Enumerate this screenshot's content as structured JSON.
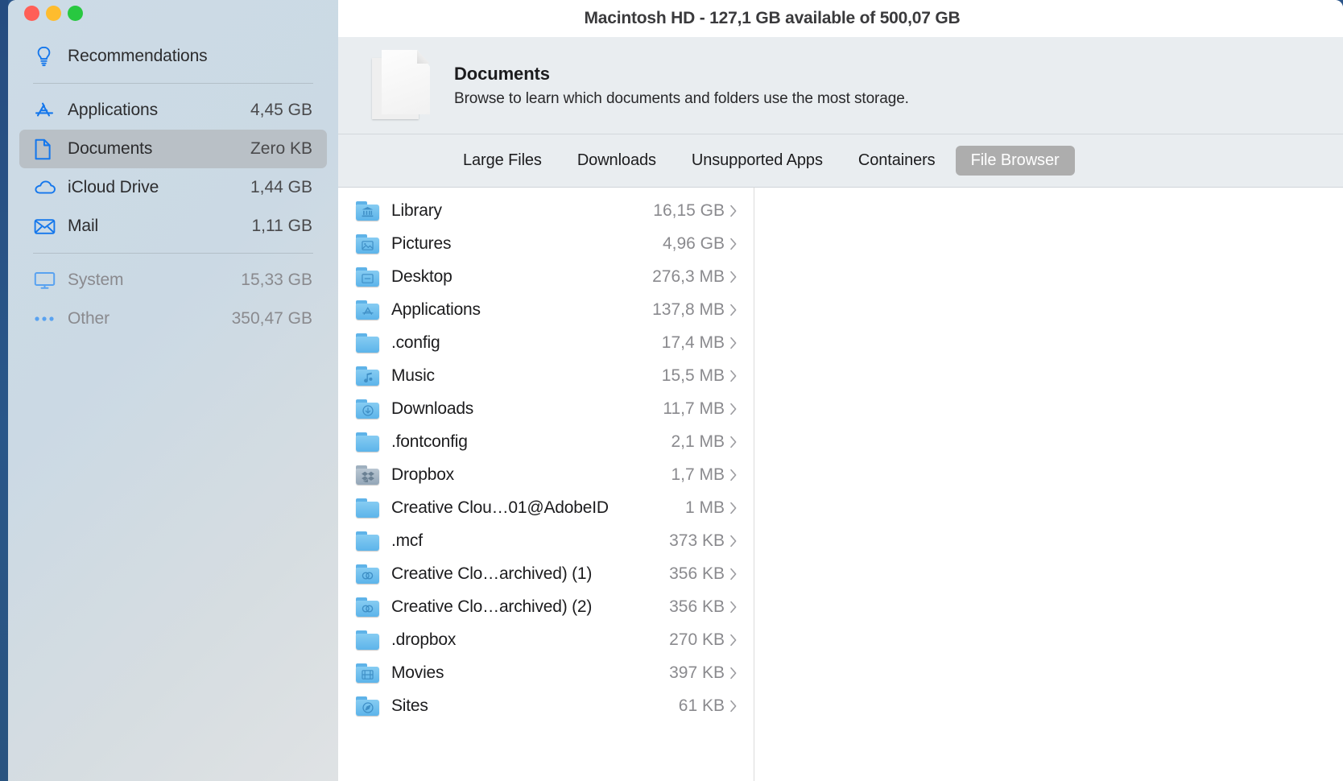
{
  "window": {
    "title": "Macintosh HD - 127,1 GB available of 500,07 GB",
    "traffic_lights": {
      "close_color": "#ff5f57",
      "minimize_color": "#febc2e",
      "maximize_color": "#28c840"
    }
  },
  "sidebar": {
    "items": [
      {
        "label": "Recommendations",
        "size": "",
        "icon": "lightbulb-icon",
        "selected": false,
        "dim": false
      },
      {
        "label": "Applications",
        "size": "4,45 GB",
        "icon": "app-store-icon",
        "selected": false,
        "dim": false
      },
      {
        "label": "Documents",
        "size": "Zero KB",
        "icon": "document-icon",
        "selected": true,
        "dim": false
      },
      {
        "label": "iCloud Drive",
        "size": "1,44 GB",
        "icon": "cloud-icon",
        "selected": false,
        "dim": false
      },
      {
        "label": "Mail",
        "size": "1,11 GB",
        "icon": "envelope-icon",
        "selected": false,
        "dim": false
      },
      {
        "label": "System",
        "size": "15,33 GB",
        "icon": "display-icon",
        "selected": false,
        "dim": true
      },
      {
        "label": "Other",
        "size": "350,47 GB",
        "icon": "ellipsis-icon",
        "selected": false,
        "dim": true
      }
    ]
  },
  "banner": {
    "icon": "documents-stack-icon",
    "title": "Documents",
    "subtitle": "Browse to learn which documents and folders use the most storage."
  },
  "tabs": [
    {
      "label": "Large Files",
      "active": false
    },
    {
      "label": "Downloads",
      "active": false
    },
    {
      "label": "Unsupported Apps",
      "active": false
    },
    {
      "label": "Containers",
      "active": false
    },
    {
      "label": "File Browser",
      "active": true
    }
  ],
  "file_browser": {
    "rows": [
      {
        "name": "Library",
        "size": "16,15 GB",
        "glyph": "bank",
        "grey": false
      },
      {
        "name": "Pictures",
        "size": "4,96 GB",
        "glyph": "photo",
        "grey": false
      },
      {
        "name": "Desktop",
        "size": "276,3 MB",
        "glyph": "desktop",
        "grey": false
      },
      {
        "name": "Applications",
        "size": "137,8 MB",
        "glyph": "appstore",
        "grey": false
      },
      {
        "name": ".config",
        "size": "17,4 MB",
        "glyph": "plain",
        "grey": false
      },
      {
        "name": "Music",
        "size": "15,5 MB",
        "glyph": "note",
        "grey": false
      },
      {
        "name": "Downloads",
        "size": "11,7 MB",
        "glyph": "download",
        "grey": false
      },
      {
        "name": ".fontconfig",
        "size": "2,1 MB",
        "glyph": "plain",
        "grey": false
      },
      {
        "name": "Dropbox",
        "size": "1,7 MB",
        "glyph": "dropbox",
        "grey": true
      },
      {
        "name": "Creative Clou…01@AdobeID",
        "size": "1 MB",
        "glyph": "plain",
        "grey": false
      },
      {
        "name": ".mcf",
        "size": "373 KB",
        "glyph": "plain",
        "grey": false
      },
      {
        "name": "Creative Clo…archived) (1)",
        "size": "356 KB",
        "glyph": "creativecloud",
        "grey": false
      },
      {
        "name": "Creative Clo…archived) (2)",
        "size": "356 KB",
        "glyph": "creativecloud",
        "grey": false
      },
      {
        "name": ".dropbox",
        "size": "270 KB",
        "glyph": "plain",
        "grey": false
      },
      {
        "name": "Movies",
        "size": "397 KB",
        "glyph": "film",
        "grey": false
      },
      {
        "name": "Sites",
        "size": "61 KB",
        "glyph": "compass",
        "grey": false
      }
    ],
    "disclosure_icon": "chevron-right-icon"
  },
  "colors": {
    "accent": "#1577ec",
    "selected_row": "#b9c0c6",
    "active_tab": "#adadad",
    "banner_bg": "#e9edf0",
    "folder_blue": "#5db4ea"
  }
}
